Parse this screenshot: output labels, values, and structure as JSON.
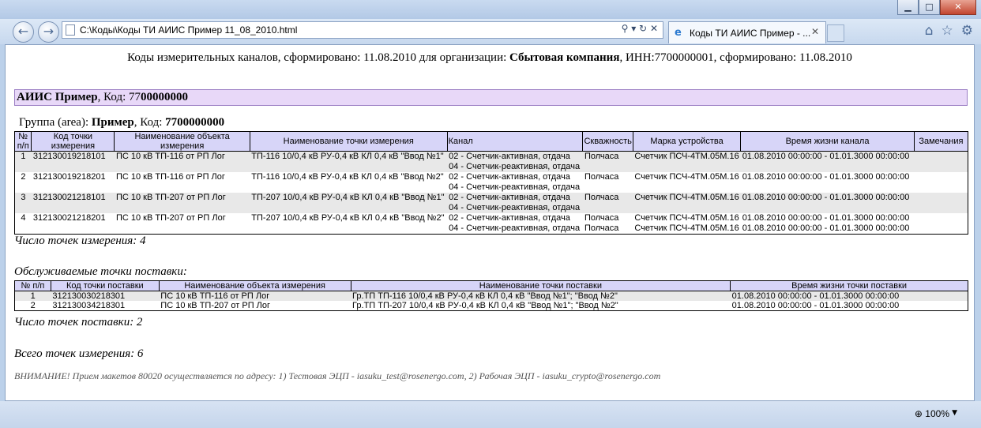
{
  "browser": {
    "address": "C:\\Коды\\Коды ТИ АИИС Пример  11_08_2010.html",
    "tab_title": "Коды ТИ АИИС Пример - ...",
    "zoom": "100%"
  },
  "header": {
    "prefix": "Коды измерительных каналов, сформировано: 11.08.2010 для организации: ",
    "org_name": "Сбытовая компания",
    "suffix": ", ИНН:7700000001, сформировано: 11.08.2010"
  },
  "org_box": {
    "name": "АИИС Пример",
    "code_label": ", Код: 77",
    "code_bold": "00000000"
  },
  "group": {
    "label": "Группа (area): ",
    "name": "Пример",
    "code_label": ", Код: ",
    "code": "7700000000"
  },
  "points_table": {
    "headers": [
      "№ п/п",
      "Код точки измерения",
      "Наименование объекта измерения",
      "Наименование точки измерения",
      "Канал",
      "Скважность",
      "Марка устройства",
      "Время жизни канала",
      "Замечания"
    ],
    "rows": [
      {
        "num": "1",
        "code": "312130019218101",
        "object": "ПС 10 кВ ТП-116 от РП Лог",
        "point": "ТП-116 10/0,4 кВ РУ-0,4 кВ КЛ 0,4 кВ \"Ввод №1\"",
        "ch1": "02 - Счетчик-активная, отдача",
        "ch2": "04 - Счетчик-реактивная, отдача",
        "duty": "Полчаса",
        "device": "Счетчик ПСЧ-4ТМ.05М.16",
        "life": "01.08.2010 00:00:00 - 01.01.3000 00:00:00"
      },
      {
        "num": "2",
        "code": "312130019218201",
        "object": "ПС 10 кВ ТП-116 от РП Лог",
        "point": "ТП-116 10/0,4 кВ РУ-0,4 кВ КЛ 0,4 кВ \"Ввод №2\"",
        "ch1": "02 - Счетчик-активная, отдача",
        "ch2": "04 - Счетчик-реактивная, отдача",
        "duty": "Полчаса",
        "device": "Счетчик ПСЧ-4ТМ.05М.16",
        "life": "01.08.2010 00:00:00 - 01.01.3000 00:00:00"
      },
      {
        "num": "3",
        "code": "312130021218101",
        "object": "ПС 10 кВ ТП-207 от РП Лог",
        "point": "ТП-207 10/0,4 кВ РУ-0,4 кВ КЛ 0,4 кВ \"Ввод №1\"",
        "ch1": "02 - Счетчик-активная, отдача",
        "ch2": "04 - Счетчик-реактивная, отдача",
        "duty": "Полчаса",
        "device": "Счетчик ПСЧ-4ТМ.05М.16",
        "life": "01.08.2010 00:00:00 - 01.01.3000 00:00:00"
      },
      {
        "num": "4",
        "code": "312130021218201",
        "object": "ПС 10 кВ ТП-207 от РП Лог",
        "point": "ТП-207 10/0,4 кВ РУ-0,4 кВ КЛ 0,4 кВ \"Ввод №2\"",
        "ch1": "02 - Счетчик-активная, отдача",
        "ch2": "04 - Счетчик-реактивная, отдача",
        "duty": "Полчаса",
        "device": "Счетчик ПСЧ-4ТМ.05М.16",
        "life": "01.08.2010 00:00:00 - 01.01.3000 00:00:00"
      }
    ]
  },
  "measure_count": "Число точек измерения: 4",
  "delivery_title": "Обслуживаемые точки поставки:",
  "delivery_table": {
    "headers": [
      "№ п/п",
      "Код точки поставки",
      "Наименование объекта измерения",
      "Наименование точки поставки",
      "Время жизни точки поставки"
    ],
    "rows": [
      {
        "num": "1",
        "code": "312130030218301",
        "object": "ПС 10 кВ ТП-116 от РП Лог",
        "point": "Гр.ТП ТП-116 10/0,4 кВ РУ-0,4 кВ КЛ 0,4 кВ \"Ввод №1\"; \"Ввод №2\"",
        "life": "01.08.2010 00:00:00 - 01.01.3000 00:00:00"
      },
      {
        "num": "2",
        "code": "312130034218301",
        "object": "ПС 10 кВ ТП-207 от РП Лог",
        "point": "Гр.ТП ТП-207 10/0,4 кВ РУ-0,4 кВ КЛ 0,4 кВ \"Ввод №1\"; \"Ввод №2\"",
        "life": "01.08.2010 00:00:00 - 01.01.3000 00:00:00"
      }
    ]
  },
  "delivery_count": "Число точек поставки: 2",
  "total_count": "Всего точек измерения: 6",
  "notice": "ВНИМАНИЕ! Прием макетов 80020 осуществляется по адресу: 1) Тестовая ЭЦП - iasuku_test@rosenergo.com, 2) Рабочая ЭЦП - iasuku_crypto@rosenergo.com"
}
